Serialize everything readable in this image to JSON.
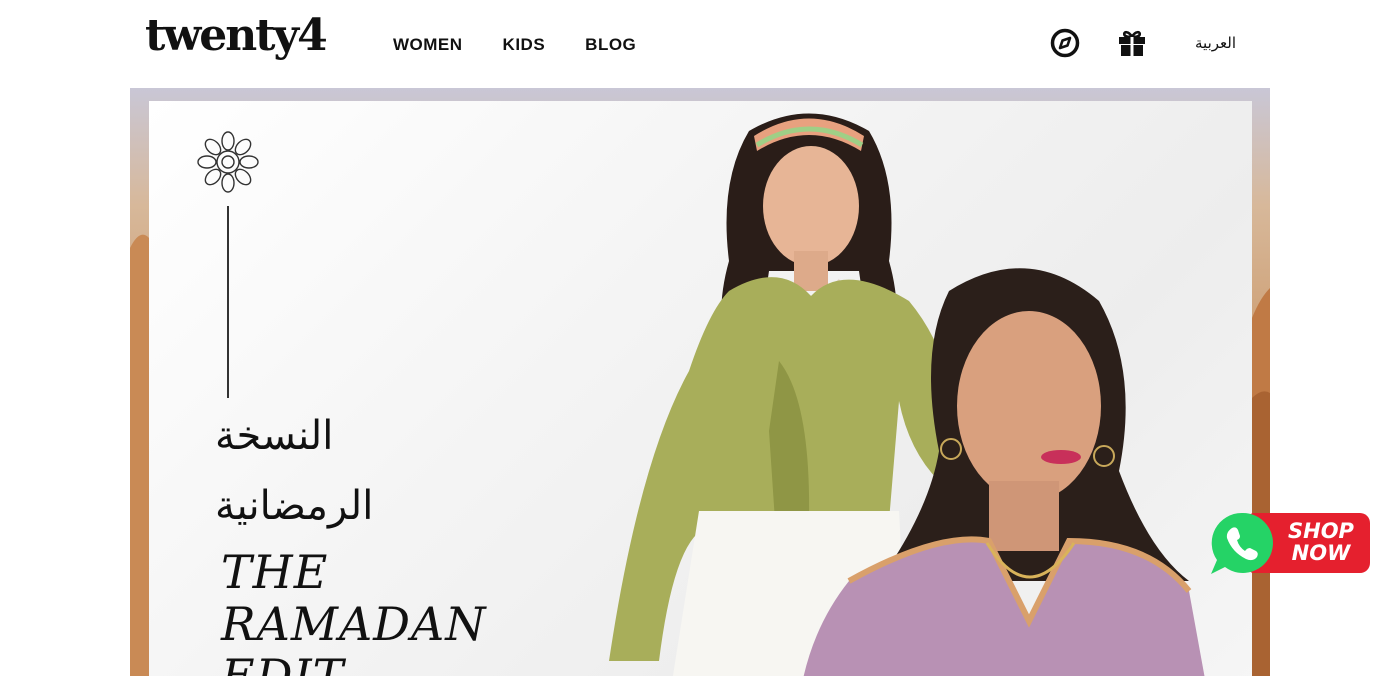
{
  "header": {
    "logo_text": "twenty4",
    "nav": [
      {
        "label": "WOMEN"
      },
      {
        "label": "KIDS"
      },
      {
        "label": "BLOG"
      }
    ],
    "icons": [
      "compass-icon",
      "gift-icon"
    ],
    "language_label": "العربية"
  },
  "hero": {
    "arabic_title_line1": "النسخة",
    "arabic_title_line2": "الرمضانية",
    "english_title_line1": "THE",
    "english_title_line2": "RAMADAN",
    "english_title_line3": "EDIT"
  },
  "whatsapp_cta": {
    "line1": "SHOP",
    "line2": "NOW",
    "colors": {
      "green": "#25D366",
      "red": "#E5202E"
    }
  }
}
